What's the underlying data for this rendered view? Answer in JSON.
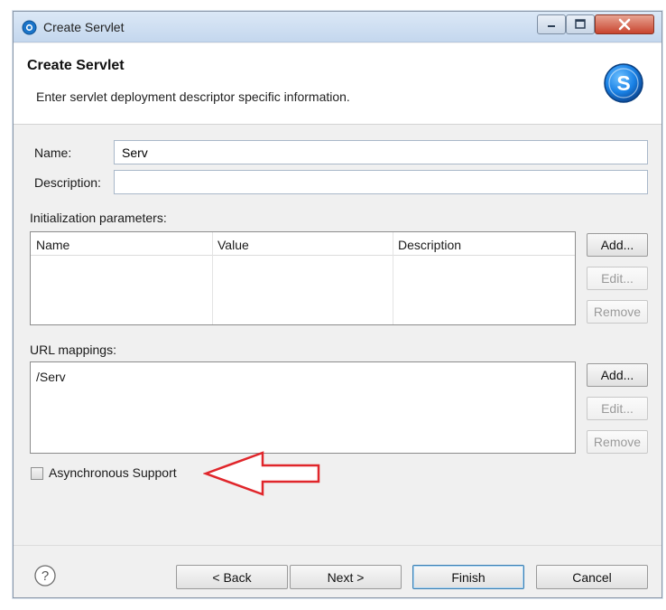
{
  "window": {
    "title": "Create Servlet",
    "icon": "servlet-icon"
  },
  "header": {
    "title": "Create Servlet",
    "description": "Enter servlet deployment descriptor specific information.",
    "logo_letter": "S"
  },
  "form": {
    "name_label": "Name:",
    "name_value": "Serv",
    "description_label": "Description:",
    "description_value": "",
    "init_params": {
      "label": "Initialization parameters:",
      "columns": [
        "Name",
        "Value",
        "Description"
      ],
      "buttons": {
        "add": "Add...",
        "edit": "Edit...",
        "remove": "Remove"
      }
    },
    "url_mappings": {
      "label": "URL mappings:",
      "items": [
        "/Serv"
      ],
      "buttons": {
        "add": "Add...",
        "edit": "Edit...",
        "remove": "Remove"
      }
    },
    "async_support": {
      "label": "Asynchronous Support",
      "checked": false
    }
  },
  "footer": {
    "help_icon": "help-icon",
    "back": "< Back",
    "next": "Next >",
    "finish": "Finish",
    "cancel": "Cancel"
  },
  "colors": {
    "arrow": "#e0262b",
    "accent": "#1a6fc9"
  }
}
